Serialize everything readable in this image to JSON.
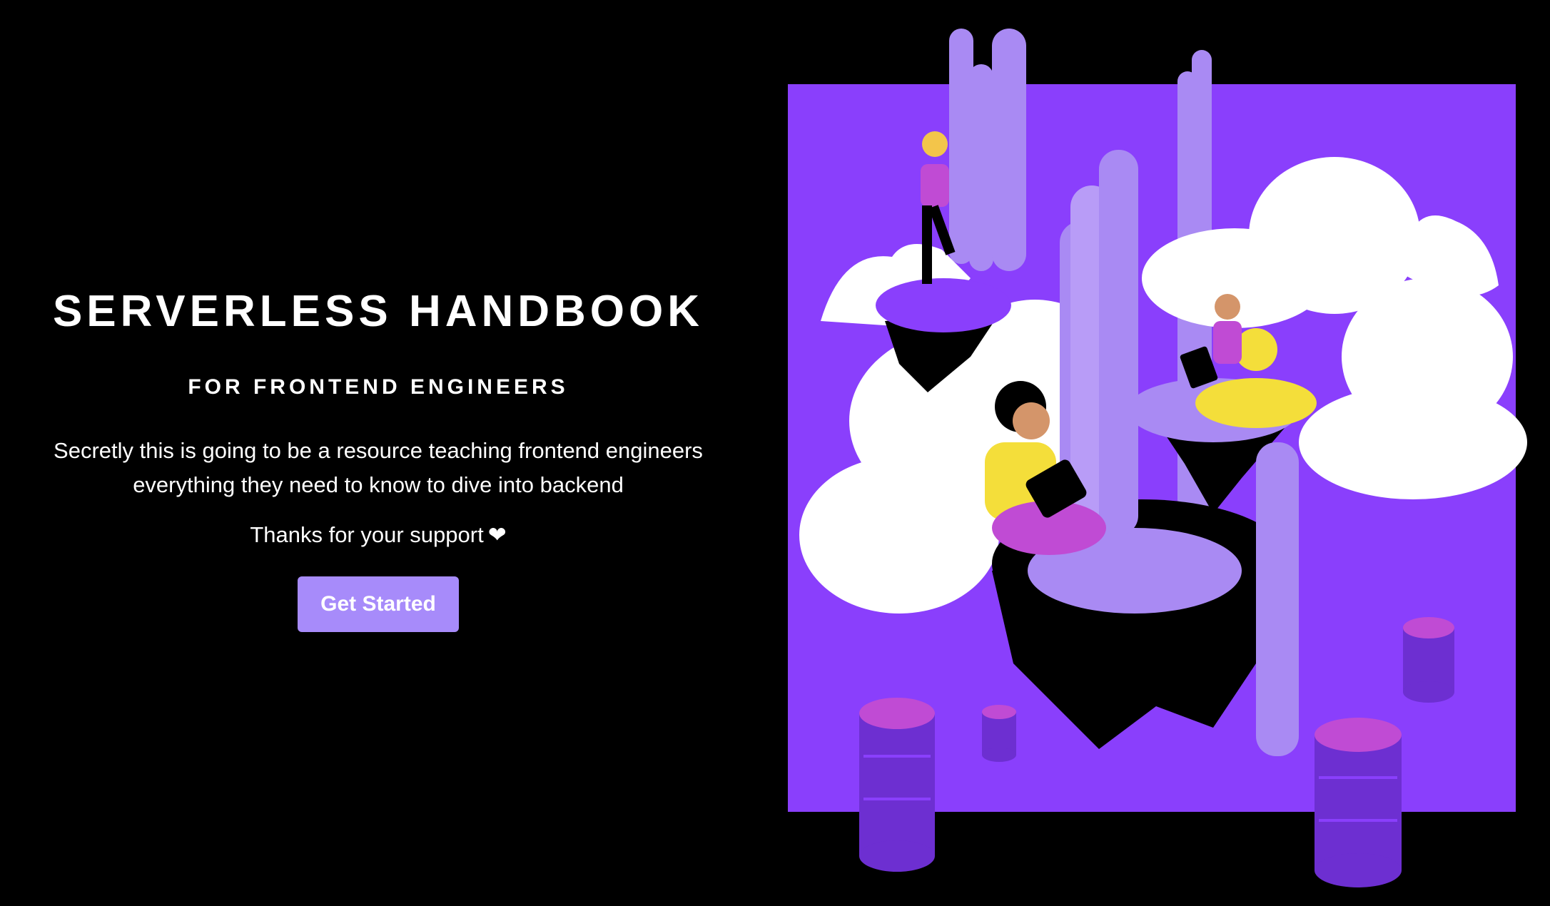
{
  "hero": {
    "title": "SERVERLESS HANDBOOK",
    "subtitle": "FOR FRONTEND ENGINEERS",
    "description_line1": "Secretly this is going to be a resource teaching frontend engineers",
    "description_line2": "everything they need to know to dive into backend",
    "thanks": "Thanks for your support",
    "heart": "❤",
    "cta_label": "Get Started"
  },
  "colors": {
    "background": "#000000",
    "accent": "#a78bfa",
    "illustration_bg": "#8a3ffc"
  }
}
